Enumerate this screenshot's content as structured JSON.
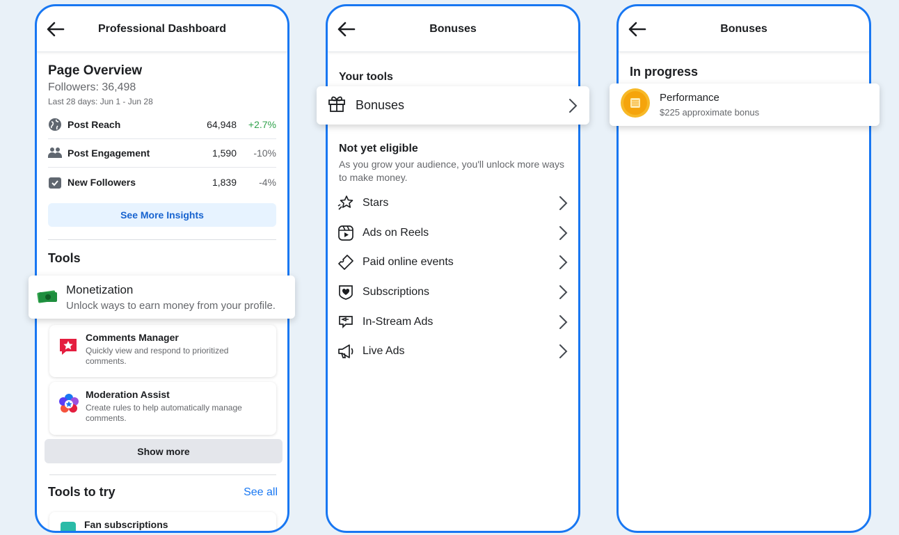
{
  "screen1": {
    "header_title": "Professional Dashboard",
    "overview": {
      "title": "Page Overview",
      "followers": "Followers: 36,498",
      "period": "Last 28 days: Jun 1 - Jun 28",
      "metrics": [
        {
          "label": "Post Reach",
          "value": "64,948",
          "change": "+2.7%"
        },
        {
          "label": "Post Engagement",
          "value": "1,590",
          "change": "-10%"
        },
        {
          "label": "New Followers",
          "value": "1,839",
          "change": "-4%"
        }
      ],
      "insights_button": "See More Insights"
    },
    "tools_title": "Tools",
    "monetization": {
      "name": "Monetization",
      "desc": "Unlock ways to earn money from your profile."
    },
    "comments_manager": {
      "name": "Comments Manager",
      "desc": "Quickly view and respond to prioritized comments."
    },
    "moderation_assist": {
      "name": "Moderation Assist",
      "desc": "Create rules to help automatically manage comments."
    },
    "show_more": "Show more",
    "tools_to_try": {
      "title": "Tools to try",
      "see_all": "See all"
    },
    "fan_subscriptions": "Fan subscriptions"
  },
  "screen2": {
    "header_title": "Bonuses",
    "your_tools": "Your tools",
    "bonuses_item": "Bonuses",
    "not_eligible_title": "Not yet eligible",
    "not_eligible_desc": "As you grow your audience, you'll unlock more ways to make money.",
    "items": [
      "Stars",
      "Ads on Reels",
      "Paid online events",
      "Subscriptions",
      "In-Stream Ads",
      "Live Ads"
    ]
  },
  "screen3": {
    "header_title": "Bonuses",
    "in_progress": "In progress",
    "performance": {
      "name": "Performance",
      "desc": "$225 approximate bonus"
    }
  },
  "colors": {
    "accent": "#1877f2",
    "positive": "#31a24c",
    "muted": "#65676b"
  }
}
